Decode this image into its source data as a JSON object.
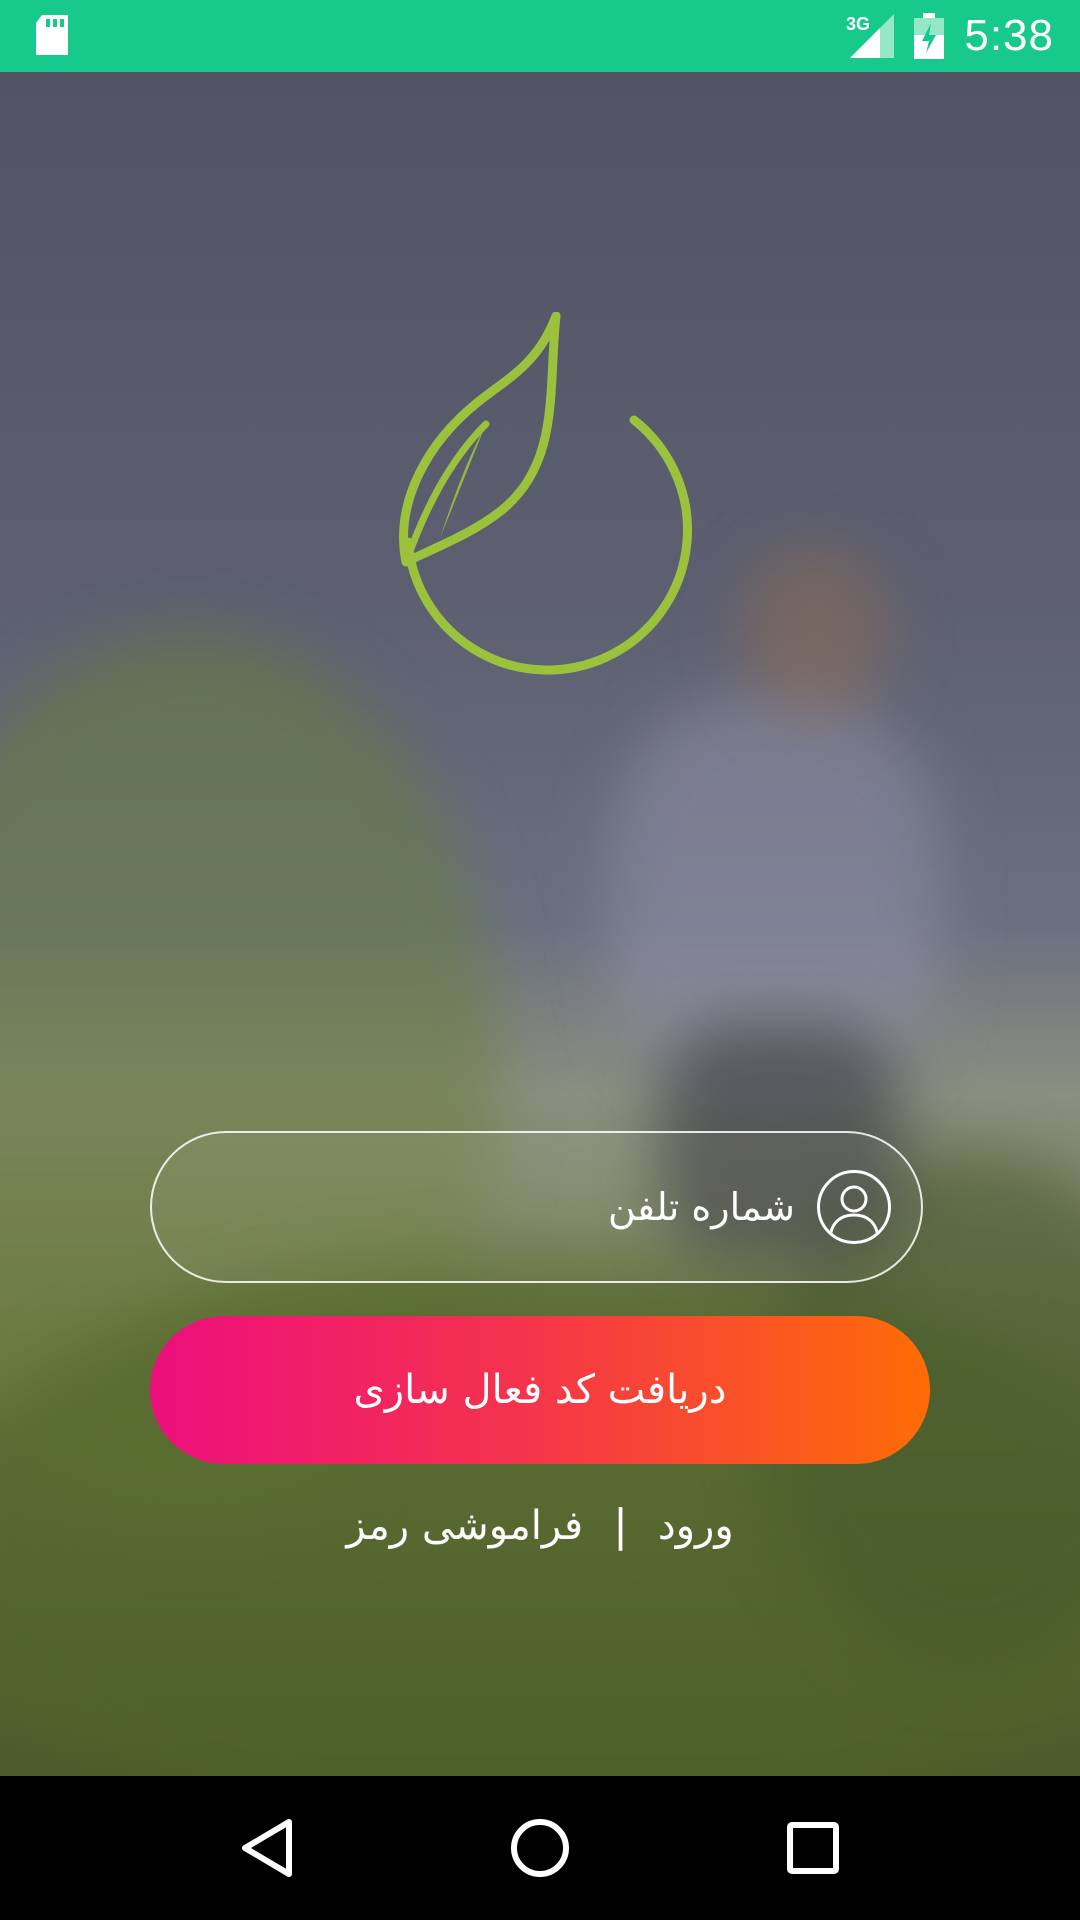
{
  "status_bar": {
    "time": "5:38",
    "network": "3G",
    "icons": [
      "sd-card-icon",
      "signal-icon",
      "battery-charging-icon"
    ]
  },
  "login": {
    "phone_placeholder": "شماره تلفن",
    "activate_button": "دریافت کد فعال سازی",
    "login_link": "ورود",
    "separator": "|",
    "forgot_link": "فراموشی رمز"
  },
  "nav_bar": {
    "icons": [
      "back-icon",
      "home-icon",
      "recents-icon"
    ]
  },
  "colors": {
    "status_bar": "#17c98b",
    "logo": "#9cc13d",
    "button_start": "#ec0f7d",
    "button_end": "#fe6c06"
  }
}
